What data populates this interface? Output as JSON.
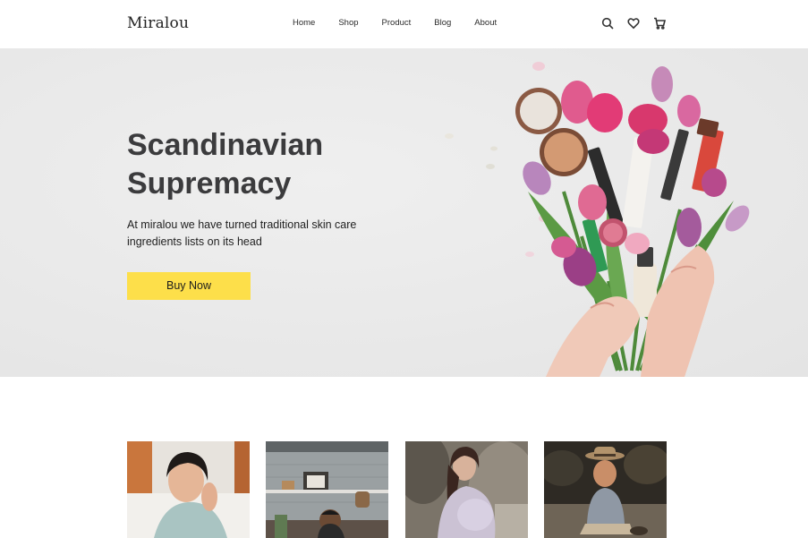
{
  "brand": {
    "logo": "Miralou"
  },
  "nav": {
    "items": [
      {
        "label": "Home"
      },
      {
        "label": "Shop"
      },
      {
        "label": "Product"
      },
      {
        "label": "Blog"
      },
      {
        "label": "About"
      }
    ],
    "icons": [
      "search-icon",
      "heart-icon",
      "cart-icon"
    ]
  },
  "hero": {
    "title_line1": "Scandinavian",
    "title_line2": "Supremacy",
    "subtitle": "At miralou we have turned traditional skin care ingredients lists on its head",
    "button_label": "Buy Now",
    "accent_color": "#fddf4a"
  },
  "thumbnails": [
    {
      "name": "woman-knit-sweater-photo"
    },
    {
      "name": "man-at-desk-photo"
    },
    {
      "name": "pregnant-woman-photo"
    },
    {
      "name": "child-with-hat-photo"
    }
  ]
}
